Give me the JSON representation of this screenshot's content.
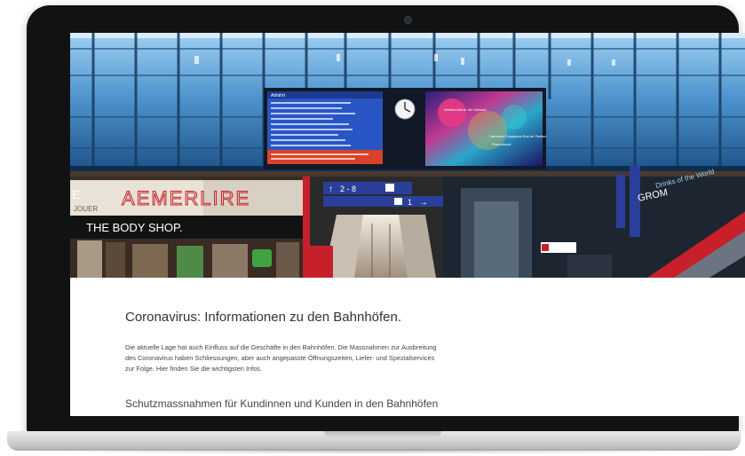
{
  "hero": {
    "store_signs": {
      "left_fragment": "E",
      "jouer": "JOUER",
      "brand_large": "AEMERLIRE",
      "body_shop": "THE BODY SHOP."
    },
    "departure_board": {
      "title": "Abfahrt",
      "ad_text": "Carrousel Fragrance Eau de Parfum",
      "ad_badge": "Weltneuheit in der Schweiz",
      "ad_brand": "Promotional"
    },
    "platform_sign_1": {
      "text": "2 - 8",
      "arrow": "↑"
    },
    "platform_sign_2": {
      "text": "1",
      "arrow": "→"
    },
    "right_signs": {
      "sign_a": "GROM",
      "sign_b": "Drinks of the World"
    }
  },
  "content": {
    "headline": "Coronavirus: Informationen zu den Bahnhöfen.",
    "intro": "Die aktuelle Lage hat auch Einfluss auf die Geschäfte in den Bahnhöfen. Die Massnahmen zur Ausbreitung des Coronavirus haben Schliessungen, aber auch angepasste Öffnungszeiten, Liefer- und Spezialservices zur Folge. Hier finden Sie die wichtigsten Infos.",
    "subheadline": "Schutzmassnahmen für Kundinnen und Kunden in den Bahnhöfen"
  },
  "colors": {
    "laptop_frame": "#101214",
    "sky_blue": "#3e86c4",
    "sign_blue": "#2a3f9c",
    "store_red": "#c8202b",
    "text_dark": "#333333"
  }
}
